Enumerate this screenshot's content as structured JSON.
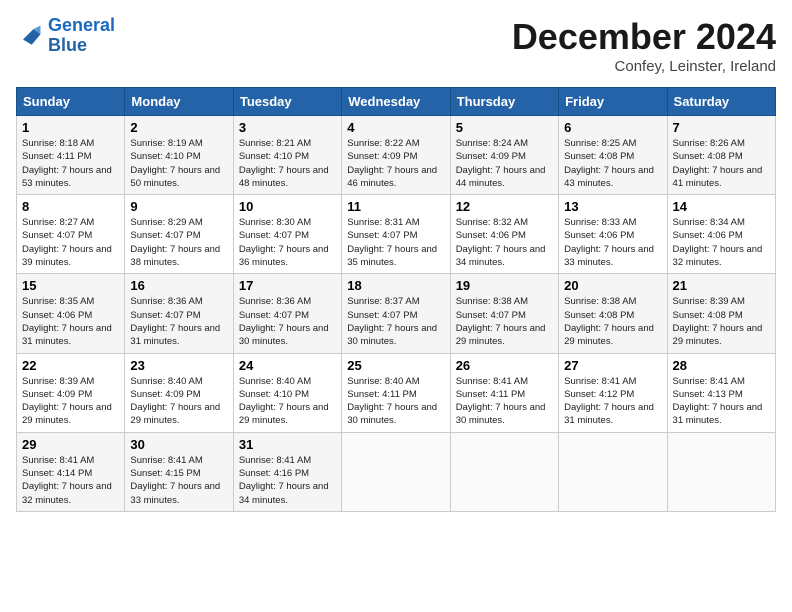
{
  "header": {
    "logo_line1": "General",
    "logo_line2": "Blue",
    "month": "December 2024",
    "location": "Confey, Leinster, Ireland"
  },
  "weekdays": [
    "Sunday",
    "Monday",
    "Tuesday",
    "Wednesday",
    "Thursday",
    "Friday",
    "Saturday"
  ],
  "weeks": [
    [
      {
        "day": "1",
        "sunrise": "8:18 AM",
        "sunset": "4:11 PM",
        "daylight": "7 hours and 53 minutes."
      },
      {
        "day": "2",
        "sunrise": "8:19 AM",
        "sunset": "4:10 PM",
        "daylight": "7 hours and 50 minutes."
      },
      {
        "day": "3",
        "sunrise": "8:21 AM",
        "sunset": "4:10 PM",
        "daylight": "7 hours and 48 minutes."
      },
      {
        "day": "4",
        "sunrise": "8:22 AM",
        "sunset": "4:09 PM",
        "daylight": "7 hours and 46 minutes."
      },
      {
        "day": "5",
        "sunrise": "8:24 AM",
        "sunset": "4:09 PM",
        "daylight": "7 hours and 44 minutes."
      },
      {
        "day": "6",
        "sunrise": "8:25 AM",
        "sunset": "4:08 PM",
        "daylight": "7 hours and 43 minutes."
      },
      {
        "day": "7",
        "sunrise": "8:26 AM",
        "sunset": "4:08 PM",
        "daylight": "7 hours and 41 minutes."
      }
    ],
    [
      {
        "day": "8",
        "sunrise": "8:27 AM",
        "sunset": "4:07 PM",
        "daylight": "7 hours and 39 minutes."
      },
      {
        "day": "9",
        "sunrise": "8:29 AM",
        "sunset": "4:07 PM",
        "daylight": "7 hours and 38 minutes."
      },
      {
        "day": "10",
        "sunrise": "8:30 AM",
        "sunset": "4:07 PM",
        "daylight": "7 hours and 36 minutes."
      },
      {
        "day": "11",
        "sunrise": "8:31 AM",
        "sunset": "4:07 PM",
        "daylight": "7 hours and 35 minutes."
      },
      {
        "day": "12",
        "sunrise": "8:32 AM",
        "sunset": "4:06 PM",
        "daylight": "7 hours and 34 minutes."
      },
      {
        "day": "13",
        "sunrise": "8:33 AM",
        "sunset": "4:06 PM",
        "daylight": "7 hours and 33 minutes."
      },
      {
        "day": "14",
        "sunrise": "8:34 AM",
        "sunset": "4:06 PM",
        "daylight": "7 hours and 32 minutes."
      }
    ],
    [
      {
        "day": "15",
        "sunrise": "8:35 AM",
        "sunset": "4:06 PM",
        "daylight": "7 hours and 31 minutes."
      },
      {
        "day": "16",
        "sunrise": "8:36 AM",
        "sunset": "4:07 PM",
        "daylight": "7 hours and 31 minutes."
      },
      {
        "day": "17",
        "sunrise": "8:36 AM",
        "sunset": "4:07 PM",
        "daylight": "7 hours and 30 minutes."
      },
      {
        "day": "18",
        "sunrise": "8:37 AM",
        "sunset": "4:07 PM",
        "daylight": "7 hours and 30 minutes."
      },
      {
        "day": "19",
        "sunrise": "8:38 AM",
        "sunset": "4:07 PM",
        "daylight": "7 hours and 29 minutes."
      },
      {
        "day": "20",
        "sunrise": "8:38 AM",
        "sunset": "4:08 PM",
        "daylight": "7 hours and 29 minutes."
      },
      {
        "day": "21",
        "sunrise": "8:39 AM",
        "sunset": "4:08 PM",
        "daylight": "7 hours and 29 minutes."
      }
    ],
    [
      {
        "day": "22",
        "sunrise": "8:39 AM",
        "sunset": "4:09 PM",
        "daylight": "7 hours and 29 minutes."
      },
      {
        "day": "23",
        "sunrise": "8:40 AM",
        "sunset": "4:09 PM",
        "daylight": "7 hours and 29 minutes."
      },
      {
        "day": "24",
        "sunrise": "8:40 AM",
        "sunset": "4:10 PM",
        "daylight": "7 hours and 29 minutes."
      },
      {
        "day": "25",
        "sunrise": "8:40 AM",
        "sunset": "4:11 PM",
        "daylight": "7 hours and 30 minutes."
      },
      {
        "day": "26",
        "sunrise": "8:41 AM",
        "sunset": "4:11 PM",
        "daylight": "7 hours and 30 minutes."
      },
      {
        "day": "27",
        "sunrise": "8:41 AM",
        "sunset": "4:12 PM",
        "daylight": "7 hours and 31 minutes."
      },
      {
        "day": "28",
        "sunrise": "8:41 AM",
        "sunset": "4:13 PM",
        "daylight": "7 hours and 31 minutes."
      }
    ],
    [
      {
        "day": "29",
        "sunrise": "8:41 AM",
        "sunset": "4:14 PM",
        "daylight": "7 hours and 32 minutes."
      },
      {
        "day": "30",
        "sunrise": "8:41 AM",
        "sunset": "4:15 PM",
        "daylight": "7 hours and 33 minutes."
      },
      {
        "day": "31",
        "sunrise": "8:41 AM",
        "sunset": "4:16 PM",
        "daylight": "7 hours and 34 minutes."
      },
      null,
      null,
      null,
      null
    ]
  ]
}
